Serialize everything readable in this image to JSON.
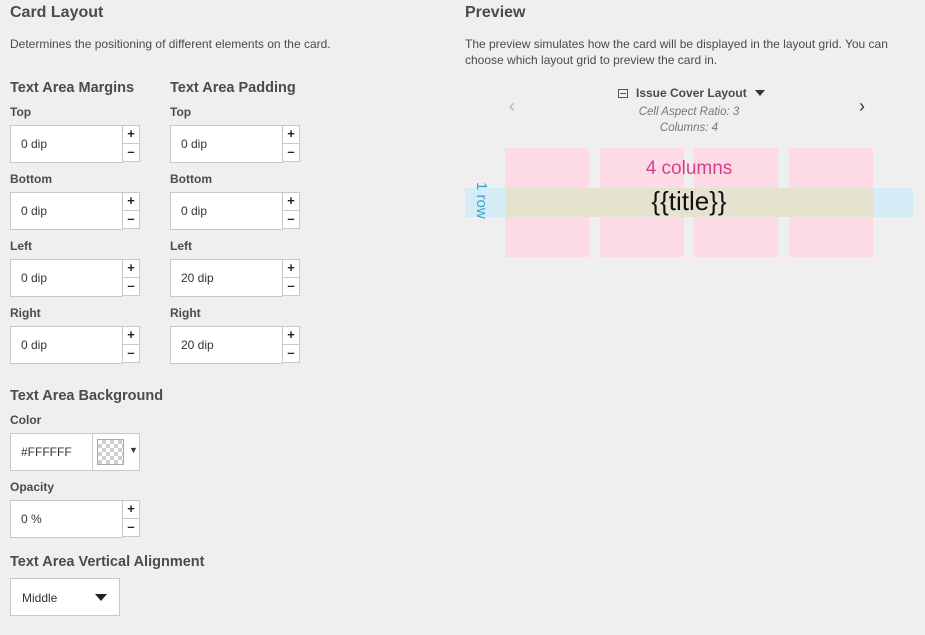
{
  "card_layout": {
    "title": "Card Layout",
    "description": "Determines the positioning of different elements on the card."
  },
  "margins": {
    "title": "Text Area Margins",
    "top_label": "Top",
    "top_value": "0 dip",
    "bottom_label": "Bottom",
    "bottom_value": "0 dip",
    "left_label": "Left",
    "left_value": "0 dip",
    "right_label": "Right",
    "right_value": "0 dip"
  },
  "padding": {
    "title": "Text Area Padding",
    "top_label": "Top",
    "top_value": "0 dip",
    "bottom_label": "Bottom",
    "bottom_value": "0 dip",
    "left_label": "Left",
    "left_value": "20 dip",
    "right_label": "Right",
    "right_value": "20 dip"
  },
  "stepper": {
    "plus": "+",
    "minus": "–"
  },
  "background": {
    "title": "Text Area Background",
    "color_label": "Color",
    "color_value": "#FFFFFF",
    "swatch_arrow": "▼",
    "opacity_label": "Opacity",
    "opacity_value": "0 %"
  },
  "alignment": {
    "title": "Text Area Vertical Alignment",
    "selected": "Middle"
  },
  "preview": {
    "title": "Preview",
    "description": "The preview simulates how the card will be displayed in the layout grid. You can choose which layout grid to preview the card in.",
    "layout_name": "Issue Cover Layout",
    "aspect_ratio": "Cell Aspect Ratio: 3",
    "columns": "Columns: 4",
    "prev_arrow": "‹",
    "next_arrow": "›",
    "columns_label": "4 columns",
    "rows_label": "1 row",
    "title_placeholder": "{{title}}"
  },
  "colors": {
    "column": "#fcdbe6",
    "row": "#d5ebf6",
    "columns_label": "#db3d8d",
    "rows_label": "#3aa0cf"
  }
}
